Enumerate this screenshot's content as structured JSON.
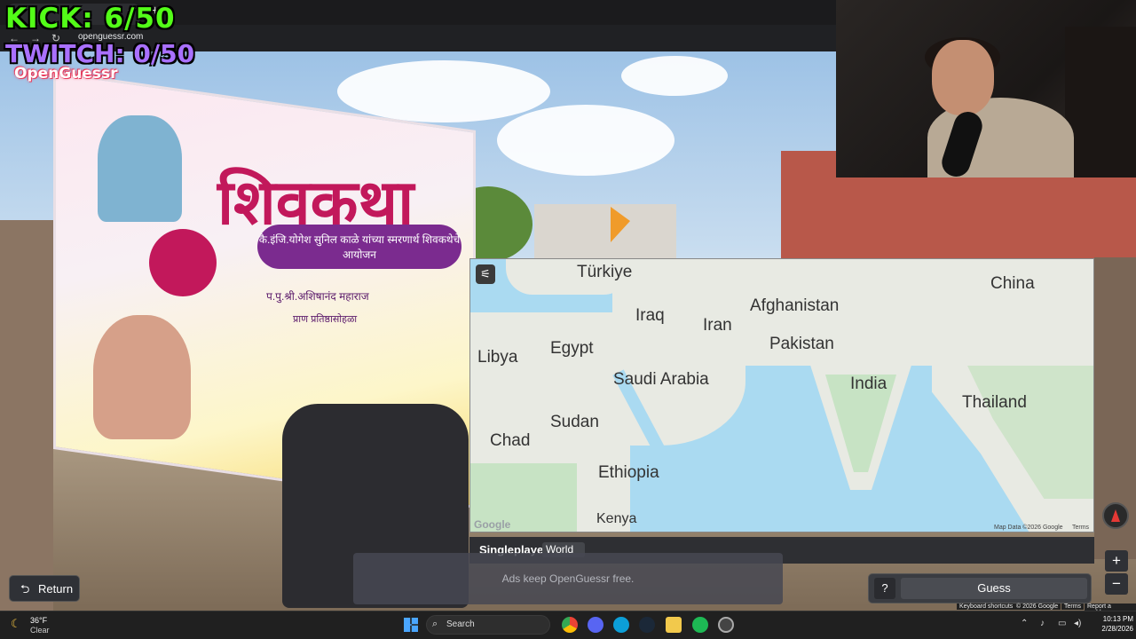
{
  "browser": {
    "url": "openguessr.com",
    "new_tab": "+",
    "tab_close": "×",
    "back": "←",
    "forward": "→",
    "reload": "↻"
  },
  "overlay": {
    "kick": "KICK: 6/50",
    "twitch": "TWITCH: 0/50",
    "logo": "OpenGuessr"
  },
  "scene": {
    "banner_title": "शिवकथा",
    "banner_sub": "कै.इंजि.योगेश सुनिल काळे यांच्या स्मरणार्थ शिवकथेचे आयोजन",
    "banner_line1": "प.पु.श्री.अशिषानंद महाराज",
    "banner_line2": "प्राण प्रतिष्ठासोहळा"
  },
  "map": {
    "settings_icon": "⚟",
    "labels": [
      "Türkiye",
      "Iraq",
      "Iran",
      "Afghanistan",
      "China",
      "Libya",
      "Egypt",
      "Pakistan",
      "Saudi Arabia",
      "India",
      "Thailand",
      "Sudan",
      "Chad",
      "Ethiopia",
      "Kenya"
    ],
    "google": "Google",
    "attribution": "Map Data ©2026 Google",
    "terms": "Terms"
  },
  "mode": {
    "label": "Singleplayer",
    "world": "World"
  },
  "ad": {
    "text": "Ads keep OpenGuessr free."
  },
  "controls": {
    "return": "Return",
    "help": "?",
    "guess": "Guess",
    "zoom_in": "+",
    "zoom_out": "−"
  },
  "sv_footer": {
    "shortcuts": "Keyboard shortcuts",
    "copyright": "© 2026 Google",
    "terms": "Terms",
    "report": "Report a problem"
  },
  "taskbar": {
    "weather_temp": "36°F",
    "weather_desc": "Clear",
    "search": "Search",
    "time": "10:13 PM",
    "date": "2/28/2026"
  },
  "colors": {
    "kick": "#53fc18",
    "twitch": "#a970ff",
    "sea": "#aadaf1",
    "land": "#e8eae3"
  }
}
